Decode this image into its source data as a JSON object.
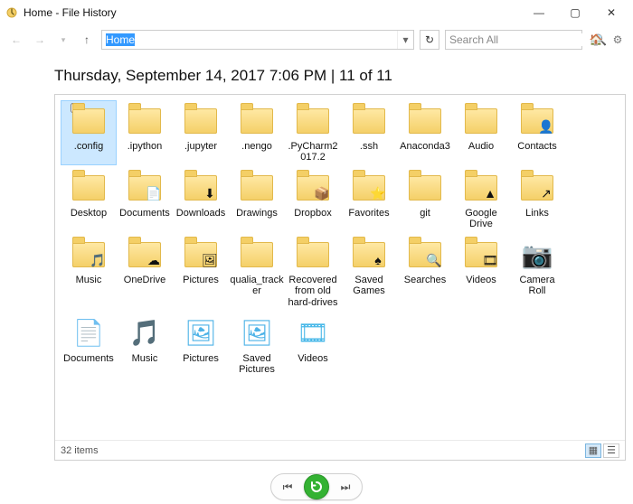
{
  "window": {
    "title": "Home - File History"
  },
  "toolbar": {
    "path_value": "Home",
    "search_placeholder": "Search All"
  },
  "heading": {
    "text": "Thursday, September 14, 2017 7:06 PM   |   11 of 11"
  },
  "items": [
    {
      "label": ".config",
      "type": "folder",
      "selected": true,
      "checkbox": true
    },
    {
      "label": ".ipython",
      "type": "folder"
    },
    {
      "label": ".jupyter",
      "type": "folder"
    },
    {
      "label": ".nengo",
      "type": "folder"
    },
    {
      "label": ".PyCharm2017.2",
      "type": "folder"
    },
    {
      "label": ".ssh",
      "type": "folder"
    },
    {
      "label": "Anaconda3",
      "type": "folder"
    },
    {
      "label": "Audio",
      "type": "folder"
    },
    {
      "label": "Contacts",
      "type": "folder",
      "overlay": "contacts"
    },
    {
      "label": "Desktop",
      "type": "folder"
    },
    {
      "label": "Documents",
      "type": "folder",
      "overlay": "document"
    },
    {
      "label": "Downloads",
      "type": "folder",
      "overlay": "download"
    },
    {
      "label": "Drawings",
      "type": "folder"
    },
    {
      "label": "Dropbox",
      "type": "folder",
      "overlay": "dropbox"
    },
    {
      "label": "Favorites",
      "type": "folder",
      "overlay": "star"
    },
    {
      "label": "git",
      "type": "folder"
    },
    {
      "label": "Google Drive",
      "type": "folder",
      "overlay": "gdrive"
    },
    {
      "label": "Links",
      "type": "folder",
      "overlay": "link"
    },
    {
      "label": "Music",
      "type": "folder",
      "overlay": "music"
    },
    {
      "label": "OneDrive",
      "type": "folder",
      "overlay": "cloud"
    },
    {
      "label": "Pictures",
      "type": "folder",
      "overlay": "picture"
    },
    {
      "label": "qualia_tracker",
      "type": "folder"
    },
    {
      "label": "Recovered from old hard-drives",
      "type": "folder"
    },
    {
      "label": "Saved Games",
      "type": "folder",
      "overlay": "game"
    },
    {
      "label": "Searches",
      "type": "folder",
      "overlay": "search"
    },
    {
      "label": "Videos",
      "type": "folder",
      "overlay": "video"
    },
    {
      "label": "Camera Roll",
      "type": "library",
      "lib": "camera"
    },
    {
      "label": "Documents",
      "type": "library",
      "lib": "document"
    },
    {
      "label": "Music",
      "type": "library",
      "lib": "music"
    },
    {
      "label": "Pictures",
      "type": "library",
      "lib": "picture"
    },
    {
      "label": "Saved Pictures",
      "type": "library",
      "lib": "picture"
    },
    {
      "label": "Videos",
      "type": "library",
      "lib": "video"
    }
  ],
  "status": {
    "count_text": "32 items"
  },
  "icons": {
    "back": "←",
    "forward": "→",
    "drop": "▾",
    "up": "↑",
    "refresh": "↻",
    "search": "🔍",
    "home": "🏠",
    "gear": "⚙",
    "prev": "⏮",
    "restore": "↻",
    "next": "⏭",
    "minimize": "—",
    "maximize": "▢",
    "close": "✕",
    "grid_large": "▦",
    "grid_details": "☰"
  },
  "overlays": {
    "contacts": "👤",
    "document": "📄",
    "download": "⬇",
    "dropbox": "📦",
    "star": "⭐",
    "gdrive": "▲",
    "link": "↗",
    "music": "🎵",
    "cloud": "☁",
    "picture": "🖼",
    "game": "♠",
    "search": "🔍",
    "video": "🎞",
    "camera": "📷"
  },
  "lib_colors": {
    "camera": "#49b8e8",
    "document": "#7bbde6",
    "music": "#3a8fe0",
    "picture": "#4db2e7",
    "video": "#49b8e8"
  }
}
